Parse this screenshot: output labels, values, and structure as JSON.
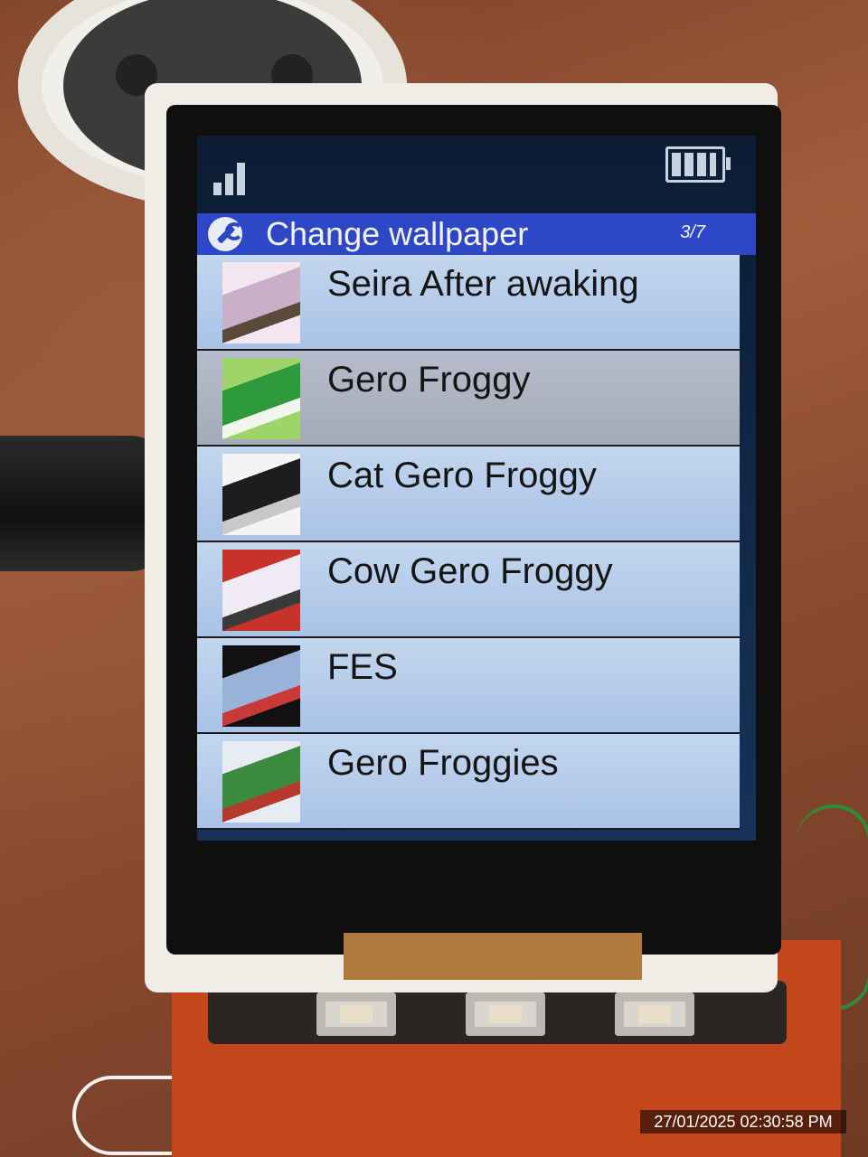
{
  "status": {
    "signal_icon": "signal-bars-icon",
    "battery_icon": "battery-full-icon"
  },
  "header": {
    "icon": "wrench-icon",
    "title": "Change wallpaper",
    "page": "3/7"
  },
  "wallpapers": [
    {
      "label": "Seira After awaking",
      "colors": [
        "#f3e6f0",
        "#c9b0c8",
        "#5a4a3a"
      ]
    },
    {
      "label": "Gero Froggy",
      "colors": [
        "#9fd46a",
        "#2f9a3c",
        "#f1f6ee"
      ]
    },
    {
      "label": "Cat Gero Froggy",
      "colors": [
        "#f4f4f4",
        "#1d1d1d",
        "#c8c8c8"
      ]
    },
    {
      "label": "Cow Gero Froggy",
      "colors": [
        "#c7322a",
        "#efeaf4",
        "#3a3a3a"
      ]
    },
    {
      "label": "FES",
      "colors": [
        "#111111",
        "#9ab2d8",
        "#c83a3a"
      ]
    },
    {
      "label": "Gero Froggies",
      "colors": [
        "#e7ecf3",
        "#3b8a3f",
        "#b7392d"
      ]
    }
  ],
  "selected_index": 1,
  "timestamp": "27/01/2025 02:30:58 PM"
}
